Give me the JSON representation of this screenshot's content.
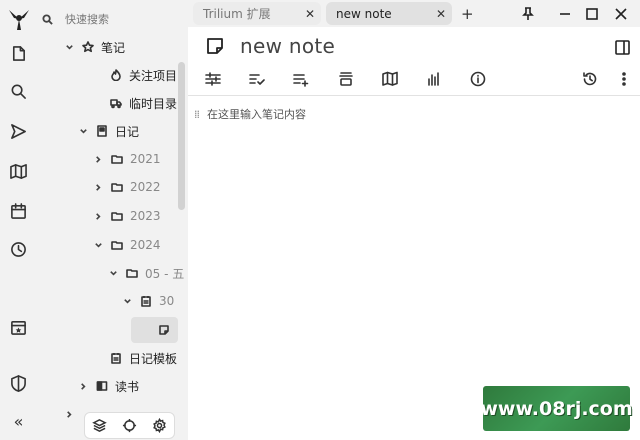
{
  "rail": {
    "icons": [
      "trilium-logo-icon",
      "new-note-icon",
      "search-icon",
      "jump-to-note-icon",
      "note-map-icon",
      "calendar-icon",
      "recent-changes-icon",
      "today-icon",
      "protected-session-icon",
      "collapse-sidebar-icon"
    ]
  },
  "tree": {
    "search_placeholder": "快速搜索",
    "items": [
      {
        "label": "笔记"
      },
      {
        "label": "关注项目"
      },
      {
        "label": "临时目录"
      },
      {
        "label": "日记"
      },
      {
        "label": "2021"
      },
      {
        "label": "2022"
      },
      {
        "label": "2023"
      },
      {
        "label": "2024"
      },
      {
        "label": "05 - 五"
      },
      {
        "label": "30"
      },
      {
        "label": ""
      },
      {
        "label": "日记模板"
      },
      {
        "label": "读书"
      },
      {
        "label": ""
      }
    ],
    "bottom_icons": [
      "layers-icon",
      "locate-icon",
      "settings-icon"
    ]
  },
  "tabs": [
    {
      "label": "Trilium 扩展",
      "active": false
    },
    {
      "label": "new note",
      "active": true
    }
  ],
  "tabbar": {
    "new_tab": "+"
  },
  "note": {
    "title": "new note",
    "placeholder": "在这里输入笔记内容",
    "toolbar_icons": [
      "note-properties-icon",
      "checklist-icon",
      "insert-list-icon",
      "align-icon",
      "note-map-icon",
      "stats-icon",
      "info-icon",
      "history-icon",
      "more-icon"
    ]
  },
  "watermark": {
    "text": "www.08rj.com"
  },
  "colors": {
    "sidebar_bg": "#f2f2f2",
    "active_tab_bg": "#e1e1e1",
    "watermark_bg": "#3d9a55"
  }
}
